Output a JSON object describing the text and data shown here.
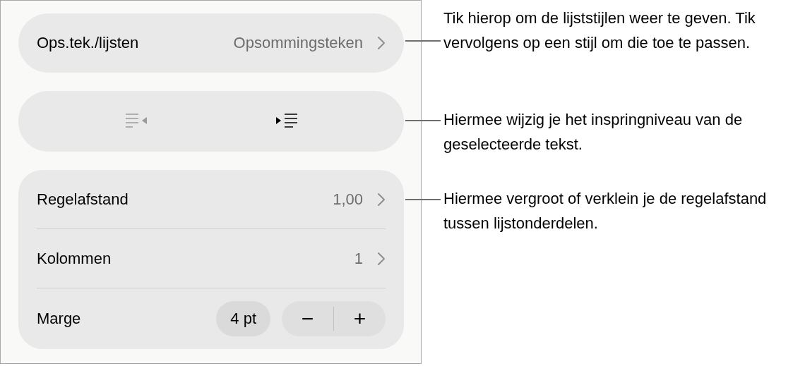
{
  "list_style": {
    "label": "Ops.tek./lijsten",
    "value": "Opsommingsteken"
  },
  "indent_buttons": [
    {
      "kind": "outdent",
      "disabled": true
    },
    {
      "kind": "indent",
      "disabled": false
    }
  ],
  "settings": [
    {
      "kind": "link",
      "label": "Regelafstand",
      "value": "1,00"
    },
    {
      "kind": "link",
      "label": "Kolommen",
      "value": "1"
    },
    {
      "kind": "stepper",
      "label": "Marge",
      "value": "4 pt",
      "minus": "−",
      "plus": "+"
    }
  ],
  "callouts": [
    "Tik hierop om de lijststijlen weer te geven. Tik vervolgens op een stijl om die toe te passen.",
    "Hiermee wijzig je het inspringniveau van de geselecteerde tekst.",
    "Hiermee vergroot of verklein je de regelafstand tussen lijstonderdelen."
  ]
}
